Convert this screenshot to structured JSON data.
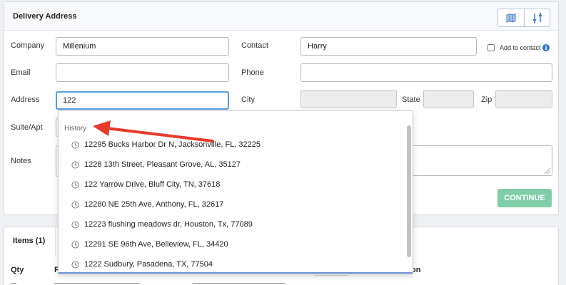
{
  "delivery": {
    "title": "Delivery Address",
    "company_label": "Company",
    "company_value": "Millenium",
    "contact_label": "Contact",
    "contact_value": "Harry",
    "add_to_contact_label": "Add to contact",
    "email_label": "Email",
    "email_value": "",
    "phone_label": "Phone",
    "phone_value": "",
    "address_label": "Address",
    "address_value": "122",
    "city_label": "City",
    "state_label": "State",
    "zip_label": "Zip",
    "suite_label": "Suite/Apt",
    "notes_label": "Notes",
    "continue_label": "CONTINUE"
  },
  "items": {
    "title": "Items (1)",
    "qty_label": "Qty",
    "col_f": "F",
    "col_on": "on"
  },
  "autocomplete": {
    "heading": "History",
    "entries": [
      "12295 Bucks Harbor Dr N, Jacksonville, FL, 32225",
      "1228 13th Street, Pleasant Grove, AL, 35127",
      "122 Yarrow Drive, Bluff City, TN, 37618",
      "12280 NE 25th Ave, Anthony, FL, 32617",
      "12223 flushing meadows dr, Houston, Tx, 77089",
      "12291 SE 96th Ave, Belleview, FL, 34420",
      "1222 Sudbury, Pasadena, TX, 77504"
    ]
  },
  "icons": {
    "map": "map-icon",
    "swap": "swap-icon",
    "clock": "clock-icon",
    "info": "info-icon"
  },
  "colors": {
    "accent_blue": "#2f6fd0",
    "continue_green": "#7fcea8",
    "annotation_red": "#e8392a"
  }
}
